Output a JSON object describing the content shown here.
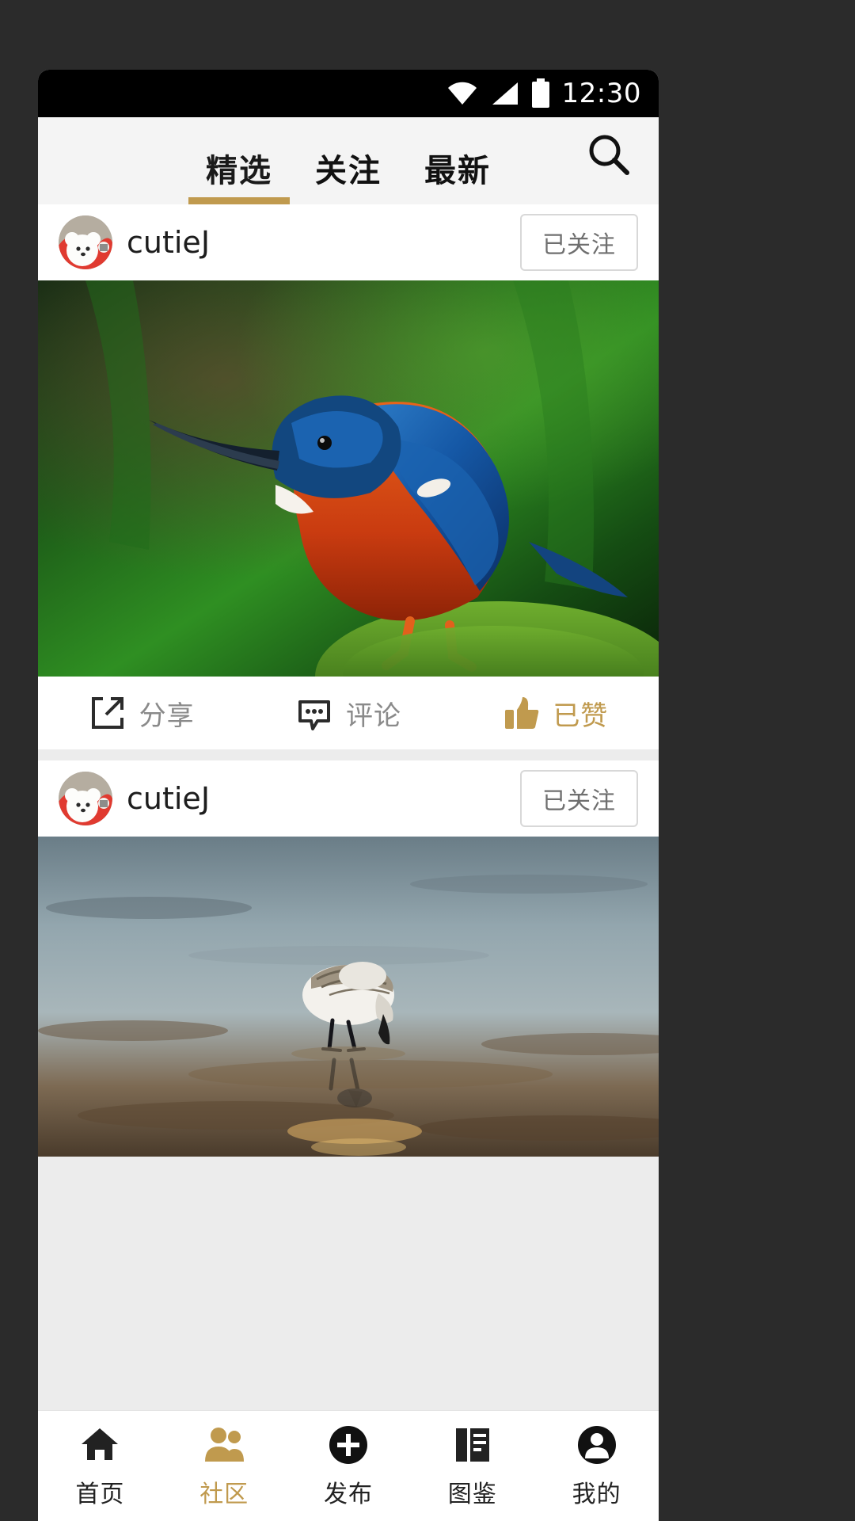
{
  "statusbar": {
    "time": "12:30",
    "icons": [
      "wifi-icon",
      "signal-icon",
      "battery-icon"
    ]
  },
  "header": {
    "tabs": [
      {
        "label": "精选",
        "active": true
      },
      {
        "label": "关注",
        "active": false
      },
      {
        "label": "最新",
        "active": false
      }
    ],
    "search_icon": "search-icon",
    "accent_color": "#c09a4e",
    "background": "#f4f4f4"
  },
  "feed": {
    "posts": [
      {
        "username": "cutieJ",
        "avatar": "dog-avatar",
        "follow_label": "已关注",
        "photo": "kingfisher-bird-on-moss",
        "actions": [
          {
            "label": "分享",
            "icon": "share-icon",
            "active": false
          },
          {
            "label": "评论",
            "icon": "comment-icon",
            "active": false
          },
          {
            "label": "已赞",
            "icon": "thumbs-up-icon",
            "active": true
          }
        ]
      },
      {
        "username": "cutieJ",
        "avatar": "dog-avatar",
        "follow_label": "已关注",
        "photo": "sandpiper-bird-on-water"
      }
    ]
  },
  "bottomnav": {
    "items": [
      {
        "label": "首页",
        "icon": "home-icon",
        "active": false
      },
      {
        "label": "社区",
        "icon": "people-icon",
        "active": true
      },
      {
        "label": "发布",
        "icon": "plus-circle-icon",
        "active": false
      },
      {
        "label": "图鉴",
        "icon": "document-icon",
        "active": false
      },
      {
        "label": "我的",
        "icon": "person-circle-icon",
        "active": false
      }
    ],
    "active_color": "#c09a4e",
    "inactive_color": "#222222"
  }
}
